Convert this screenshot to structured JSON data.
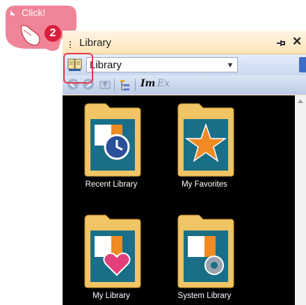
{
  "callout": {
    "label": "Click!",
    "step": "2"
  },
  "panel": {
    "title": "Library",
    "pin_icon": "pin-icon",
    "close_glyph": "✕"
  },
  "combo": {
    "value": "Library"
  },
  "toolbar": {
    "text_a": "Im",
    "text_b": "Ex"
  },
  "items": [
    {
      "label": "Recent Library",
      "icon": "recent-library-icon"
    },
    {
      "label": "My Favorites",
      "icon": "favorites-star-icon"
    },
    {
      "label": "My Library",
      "icon": "my-library-heart-icon"
    },
    {
      "label": "System Library",
      "icon": "system-library-gear-icon"
    }
  ],
  "colors": {
    "folder": "#f1c565",
    "icon_bg": "#1a6f86",
    "star": "#f08a23",
    "heart": "#e3407b",
    "accent_red": "#e23a4b"
  }
}
